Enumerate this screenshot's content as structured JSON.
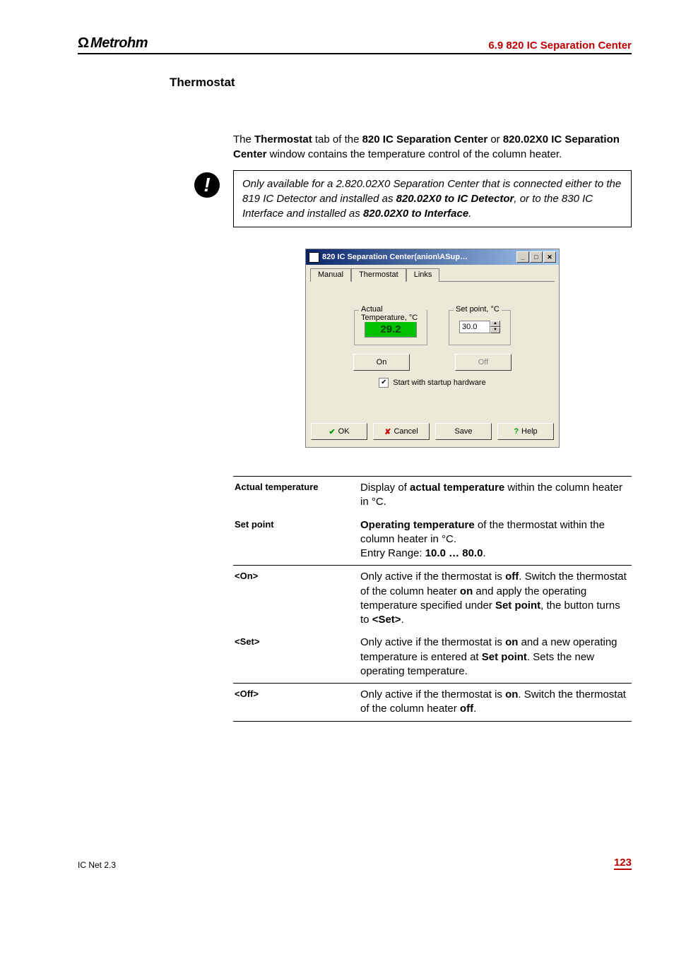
{
  "header": {
    "logo_text": "Metrohm",
    "section": "6.9  820 IC Separation Center"
  },
  "section_title": "Thermostat",
  "intro": {
    "p1_a": "The ",
    "p1_b": "Thermostat",
    "p1_c": " tab of the ",
    "p1_d": "820 IC Separation Center",
    "p1_e": " or ",
    "p1_f": "820.02X0 IC Separation Center",
    "p1_g": " window contains the temperature control of the column heater."
  },
  "note": {
    "a": "Only available for a 2.820.02X0 Separation Center that is connected either to the 819 IC Detector and installed as ",
    "b": "820.02X0 to IC Detector",
    "c": ", or to the 830 IC Interface and installed as ",
    "d": "820.02X0 to Interface",
    "e": "."
  },
  "dialog": {
    "title": "820 IC Separation Center(anion\\ASup…",
    "tabs": [
      "Manual",
      "Thermostat",
      "Links"
    ],
    "active_tab": 1,
    "actual_group": "Actual Temperature, °C",
    "actual_value": "29.2",
    "setpoint_group": "Set point, °C",
    "setpoint_value": "30.0",
    "on_label": "On",
    "off_label": "Off",
    "start_hw": "Start with startup hardware",
    "ok": "OK",
    "cancel": "Cancel",
    "save": "Save",
    "help": "Help"
  },
  "definitions": {
    "actual_temp": {
      "term": "Actual temperature",
      "a": "Display of ",
      "b": "actual temperature",
      "c": " within the column heater in °C."
    },
    "set_point": {
      "term": "Set point",
      "a": "Operating temperature",
      "b": " of the thermostat within the column heater in °C.",
      "c": "Entry Range: ",
      "d": "10.0 … 80.0",
      "e": "."
    },
    "on": {
      "term": "<On>",
      "a": "Only active if the thermostat is ",
      "b": "off",
      "c": ". Switch the thermostat of the column heater ",
      "d": "on",
      "e": " and apply the operating temperature specified under ",
      "f": "Set point",
      "g": ", the button turns to ",
      "h": "<Set>",
      "i": "."
    },
    "set": {
      "term": "<Set>",
      "a": "Only active if the thermostat is ",
      "b": "on",
      "c": " and a new operating temperature is entered at ",
      "d": "Set point",
      "e": ". Sets the new operating temperature."
    },
    "off": {
      "term": "<Off>",
      "a": "Only active if the thermostat is ",
      "b": "on",
      "c": ". Switch the thermostat of the column heater ",
      "d": "off",
      "e": "."
    }
  },
  "footer": {
    "product": "IC Net 2.3",
    "page": "123"
  }
}
